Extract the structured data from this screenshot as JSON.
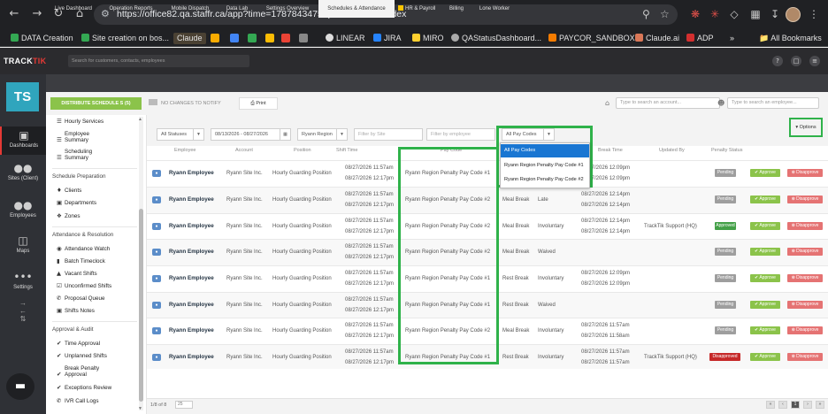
{
  "browser": {
    "url": "https://office82.qa.staffr.ca/app?time=1787843475#patrol/default/index",
    "bookmarks": [
      "DATA Creation",
      "Site creation on bos...",
      "Claude",
      "LINEAR",
      "JIRA",
      "MIRO",
      "QAStatusDashboard...",
      "PAYCOR_SANDBOX",
      "Claude.ai",
      "ADP"
    ],
    "all_bookmarks": "All Bookmarks"
  },
  "app": {
    "logo": "TRACKTIK",
    "search_placeholder": "Search for customers, contacts, employees",
    "avatar_initials": "TS"
  },
  "rail": [
    {
      "label": "Dashboards",
      "icon": "monitor-icon"
    },
    {
      "label": "Sites (Client)",
      "icon": "group-icon"
    },
    {
      "label": "Employees",
      "icon": "people-icon"
    },
    {
      "label": "Maps",
      "icon": "map-icon"
    },
    {
      "label": "Settings",
      "icon": "dots-icon"
    }
  ],
  "tabs": [
    "Live Dashboard",
    "Operation Reports",
    "Mobile Dispatch",
    "Data Lab",
    "Settings Overview",
    "Schedules & Attendance",
    "HR & Payroll",
    "Billing",
    "Lone Worker"
  ],
  "actions": {
    "distribute": "DISTRIBUTE SCHEDULE S (5)",
    "no_changes": "NO CHANGES TO NOTIFY",
    "print": "Print",
    "account_search": "Type to search an account...",
    "employee_search": "Type to search an employee..."
  },
  "subnav": {
    "items_top": [
      "Hourly Services",
      "Employee Summary",
      "Scheduling Summary"
    ],
    "section1": "Schedule Preparation",
    "section1_items": [
      "Clients",
      "Departments",
      "Zones"
    ],
    "section2": "Attendance & Resolution",
    "section2_items": [
      "Attendance Watch",
      "Batch Timeclock",
      "Vacant Shifts",
      "Unconfirmed Shifts",
      "Proposal Queue",
      "Shifts Notes"
    ],
    "section3": "Approval & Audit",
    "section3_items": [
      "Time Approval",
      "Unplanned Shifts",
      "Break Penalty Approval",
      "Exceptions Review",
      "IVR Call Logs"
    ]
  },
  "filters": {
    "status": "All Statuses",
    "date_range": "08/13/2026 - 08/27/2026",
    "region": "Ryann Region",
    "site_placeholder": "Filter by Site",
    "employee_placeholder": "Filter by employee",
    "pay_codes": "All Pay Codes",
    "options": "▾ Options"
  },
  "pay_code_dropdown": [
    "All Pay Codes",
    "Ryann Region Penalty Pay Code #1",
    "Ryann Region Penalty Pay Code #2"
  ],
  "columns": [
    "Employee",
    "Account",
    "Position",
    "Shift Time",
    "Pay Code",
    "",
    "Break Time",
    "Updated By",
    "Penalty Status"
  ],
  "rows": [
    {
      "employee": "Ryann Employee",
      "account": "Ryann Site Inc.",
      "position": "Hourly Guarding Position",
      "shift_start": "08/27/2026 11:57am",
      "shift_end": "08/27/2026 12:17pm",
      "pay_code": "Ryann Region Penalty Pay Code #1",
      "break_type": "",
      "reason": "",
      "break_start": "08/27/2026 12:09pm",
      "break_end": "08/27/2026 12:09pm",
      "updated_by": "",
      "status": "Pending"
    },
    {
      "employee": "Ryann Employee",
      "account": "Ryann Site Inc.",
      "position": "Hourly Guarding Position",
      "shift_start": "08/27/2026 11:57am",
      "shift_end": "08/27/2026 12:17pm",
      "pay_code": "Ryann Region Penalty Pay Code #2",
      "break_type": "Meal Break",
      "reason": "Late",
      "break_start": "08/27/2026 12:14pm",
      "break_end": "08/27/2026 12:14pm",
      "updated_by": "",
      "status": "Pending"
    },
    {
      "employee": "Ryann Employee",
      "account": "Ryann Site Inc.",
      "position": "Hourly Guarding Position",
      "shift_start": "08/27/2026 11:57am",
      "shift_end": "08/27/2026 12:17pm",
      "pay_code": "Ryann Region Penalty Pay Code #2",
      "break_type": "Meal Break",
      "reason": "Involuntary",
      "break_start": "08/27/2026 12:14pm",
      "break_end": "08/27/2026 12:14pm",
      "updated_by": "TrackTik Support (HQ)",
      "status": "Approved"
    },
    {
      "employee": "Ryann Employee",
      "account": "Ryann Site Inc.",
      "position": "Hourly Guarding Position",
      "shift_start": "08/27/2026 11:57am",
      "shift_end": "08/27/2026 12:17pm",
      "pay_code": "Ryann Region Penalty Pay Code #2",
      "break_type": "Meal Break",
      "reason": "Waived",
      "break_start": "",
      "break_end": "",
      "updated_by": "",
      "status": "Pending"
    },
    {
      "employee": "Ryann Employee",
      "account": "Ryann Site Inc.",
      "position": "Hourly Guarding Position",
      "shift_start": "08/27/2026 11:57am",
      "shift_end": "08/27/2026 12:17pm",
      "pay_code": "Ryann Region Penalty Pay Code #1",
      "break_type": "Rest Break",
      "reason": "Involuntary",
      "break_start": "08/27/2026 12:09pm",
      "break_end": "08/27/2026 12:09pm",
      "updated_by": "",
      "status": "Pending"
    },
    {
      "employee": "Ryann Employee",
      "account": "Ryann Site Inc.",
      "position": "Hourly Guarding Position",
      "shift_start": "08/27/2026 11:57am",
      "shift_end": "08/27/2026 12:17pm",
      "pay_code": "Ryann Region Penalty Pay Code #1",
      "break_type": "Rest Break",
      "reason": "Waived",
      "break_start": "",
      "break_end": "",
      "updated_by": "",
      "status": "Pending"
    },
    {
      "employee": "Ryann Employee",
      "account": "Ryann Site Inc.",
      "position": "Hourly Guarding Position",
      "shift_start": "08/27/2026 11:57am",
      "shift_end": "08/27/2026 12:17pm",
      "pay_code": "Ryann Region Penalty Pay Code #2",
      "break_type": "Meal Break",
      "reason": "Involuntary",
      "break_start": "08/27/2026 11:57am",
      "break_end": "08/27/2026 11:58am",
      "updated_by": "",
      "status": "Pending"
    },
    {
      "employee": "Ryann Employee",
      "account": "Ryann Site Inc.",
      "position": "Hourly Guarding Position",
      "shift_start": "08/27/2026 11:57am",
      "shift_end": "08/27/2026 12:17pm",
      "pay_code": "Ryann Region Penalty Pay Code #1",
      "break_type": "Rest Break",
      "reason": "Involuntary",
      "break_start": "08/27/2026 11:57am",
      "break_end": "08/27/2026 11:57am",
      "updated_by": "TrackTik Support (HQ)",
      "status": "Disapproved"
    }
  ],
  "row_actions": {
    "approve": "✔ Approve",
    "disapprove": "⊗ Disapprove"
  },
  "footer": {
    "page_info": "1/8 of 8",
    "page_size": "25"
  },
  "colors": {
    "accent_green": "#2fb24a",
    "brand_red": "#e53935",
    "avatar_teal": "#30a5bd",
    "select_blue": "#1976d2"
  }
}
